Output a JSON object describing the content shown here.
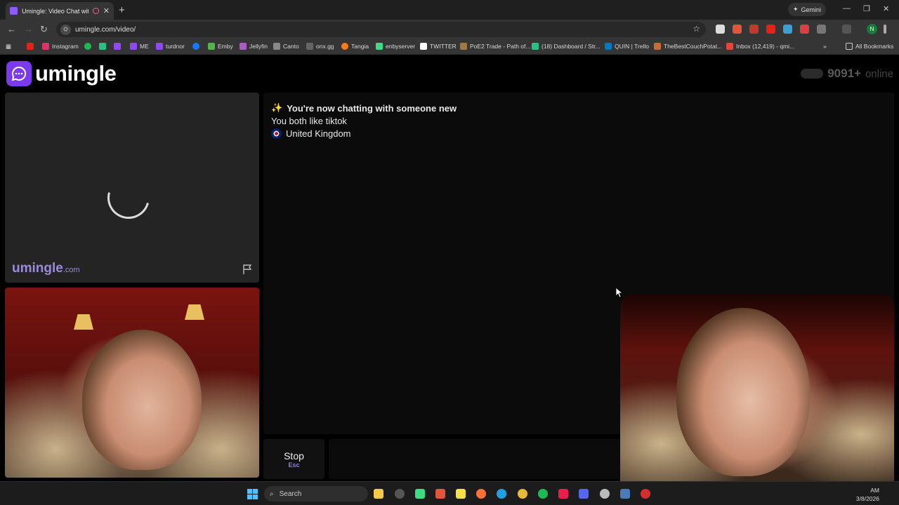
{
  "browser": {
    "tab_title": "Umingle: Video Chat with S",
    "new_tab": "+",
    "gemini_label": "Gemini",
    "url": "umingle.com/video/"
  },
  "bookmarks": [
    {
      "label": "Instagram",
      "color": "#e1306c"
    },
    {
      "label": "ME",
      "color": "#9146ff"
    },
    {
      "label": "turdnor",
      "color": "#9146ff"
    },
    {
      "label": "Emby",
      "color": "#52b54b"
    },
    {
      "label": "Jellyfin",
      "color": "#aa5cc3"
    },
    {
      "label": "Canto",
      "color": "#888888"
    },
    {
      "label": "onx.gg",
      "color": "#666666"
    },
    {
      "label": "Tangia",
      "color": "#ff7a1a"
    },
    {
      "label": "enbyserver",
      "color": "#3ddc84"
    },
    {
      "label": "TWITTER",
      "color": "#ffffff"
    },
    {
      "label": "PoE2 Trade - Path of...",
      "color": "#a07840"
    },
    {
      "label": "(18) Dashboard / Str...",
      "color": "#26c281"
    },
    {
      "label": "QUIN | Trello",
      "color": "#0079bf"
    },
    {
      "label": "TheBestCouchPotat...",
      "color": "#c86b3a"
    },
    {
      "label": "Inbox (12,419) - qmi...",
      "color": "#ea4335"
    }
  ],
  "all_bookmarks": "All Bookmarks",
  "site": {
    "logo_text": "umingle",
    "online_count": "9091+",
    "online_label": "online",
    "watermark_name": "umingle",
    "watermark_domain": ".com"
  },
  "chat": {
    "line1_emoji": "✨",
    "line1": "You're now chatting with someone new",
    "line2": "You both like tiktok",
    "line3": "United Kingdom"
  },
  "controls": {
    "stop_label": "Stop",
    "stop_key": "Esc"
  },
  "taskbar": {
    "search_label": "Search",
    "time": "AM",
    "date": "3/8/2026"
  }
}
